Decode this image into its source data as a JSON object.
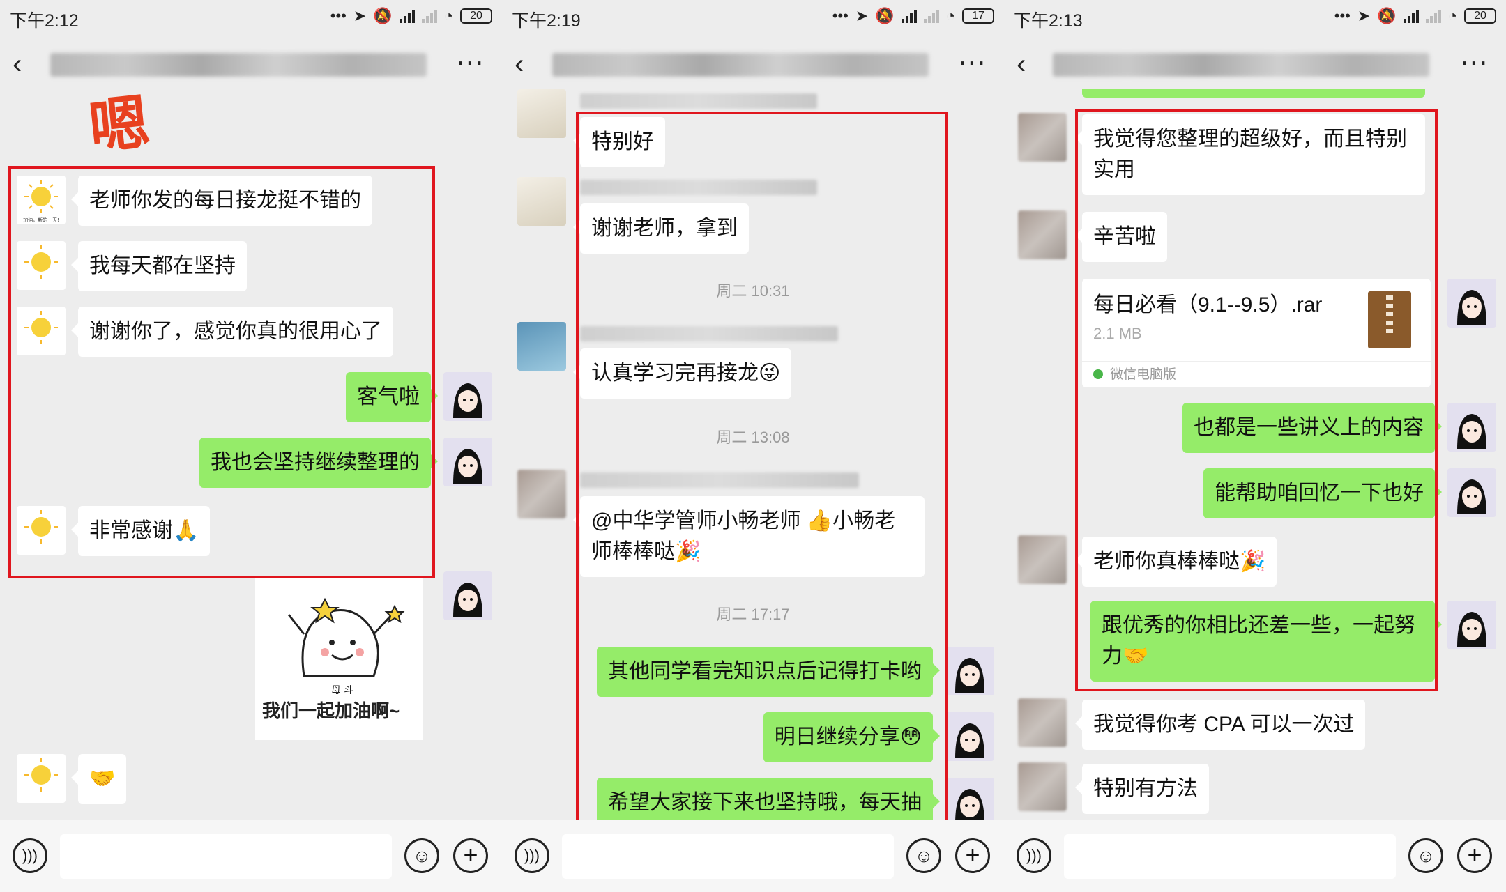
{
  "screens": [
    {
      "status_time": "下午2:12",
      "battery": "20",
      "stickers": {
        "en_char": "嗯",
        "cheer_text": "我们一起加油啊~",
        "cheer_sub": "母 斗"
      },
      "messages": [
        {
          "text": "老师你发的每日接龙挺不错的"
        },
        {
          "text": "我每天都在坚持"
        },
        {
          "text": "谢谢你了，感觉你真的很用心了"
        },
        {
          "text": "客气啦"
        },
        {
          "text": "我也会坚持继续整理的"
        },
        {
          "text": "非常感谢🙏"
        },
        {
          "text": "🤝"
        }
      ],
      "avatar_caption": "加油，新的一天!"
    },
    {
      "status_time": "下午2:19",
      "battery": "17",
      "messages": [
        {
          "text": "特别好"
        },
        {
          "text": "谢谢老师，拿到"
        },
        {
          "text": "认真学习完再接龙😜"
        },
        {
          "text": "@中华学管师小畅老师 👍小畅老师棒棒哒🎉"
        },
        {
          "text": "其他同学看完知识点后记得打卡哟"
        },
        {
          "text": "明日继续分享😳"
        },
        {
          "text": "希望大家接下来也坚持哦，每天抽"
        }
      ],
      "timestamps": [
        "周二 10:31",
        "周二 13:08",
        "周二 17:17"
      ]
    },
    {
      "status_time": "下午2:13",
      "battery": "20",
      "messages": [
        {
          "text": "我觉得您整理的超级好，而且特别实用"
        },
        {
          "text": "辛苦啦"
        },
        {
          "text": "也都是一些讲义上的内容"
        },
        {
          "text": "能帮助咱回忆一下也好"
        },
        {
          "text": "老师你真棒棒哒🎉"
        },
        {
          "text": "跟优秀的你相比还差一些，一起努力🤝"
        },
        {
          "text": "我觉得你考 CPA 可以一次过"
        },
        {
          "text": "特别有方法"
        }
      ],
      "file": {
        "name": "每日必看（9.1--9.5）.rar",
        "size": "2.1 MB",
        "source": "微信电脑版"
      }
    }
  ]
}
